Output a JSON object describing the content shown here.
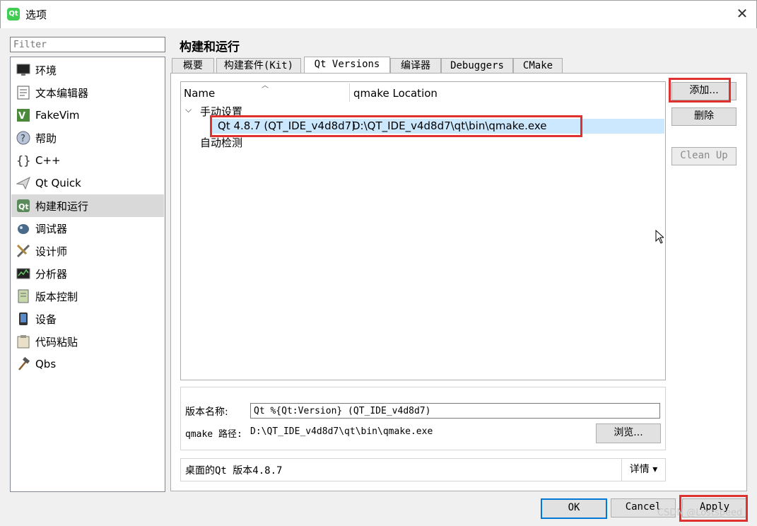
{
  "window": {
    "icon_text": "Qt",
    "title": "选项",
    "close": "✕"
  },
  "sidebar": {
    "filter_placeholder": "Filter",
    "items": [
      {
        "label": "环境",
        "icon": "monitor-icon"
      },
      {
        "label": "文本编辑器",
        "icon": "text-editor-icon"
      },
      {
        "label": "FakeVim",
        "icon": "fakevim-icon"
      },
      {
        "label": "帮助",
        "icon": "help-icon"
      },
      {
        "label": "C++",
        "icon": "braces-icon"
      },
      {
        "label": "Qt Quick",
        "icon": "paper-plane-icon"
      },
      {
        "label": "构建和运行",
        "icon": "qt-build-icon"
      },
      {
        "label": "调试器",
        "icon": "bug-icon"
      },
      {
        "label": "设计师",
        "icon": "designer-tools-icon"
      },
      {
        "label": "分析器",
        "icon": "analyzer-icon"
      },
      {
        "label": "版本控制",
        "icon": "version-control-icon"
      },
      {
        "label": "设备",
        "icon": "device-icon"
      },
      {
        "label": "代码粘贴",
        "icon": "clipboard-icon"
      },
      {
        "label": "Qbs",
        "icon": "hammer-icon"
      }
    ],
    "selected_index": 6
  },
  "main": {
    "title": "构建和运行",
    "tabs": [
      "概要",
      "构建套件(Kit)",
      "Qt Versions",
      "编译器",
      "Debuggers",
      "CMake"
    ],
    "active_tab": 2,
    "tree": {
      "columns": [
        "Name",
        "qmake Location"
      ],
      "groups": [
        {
          "label": "手动设置",
          "expanded": true,
          "children": [
            {
              "name": "Qt 4.8.7 (QT_IDE_v4d8d7)",
              "location": "D:\\QT_IDE_v4d8d7\\qt\\bin\\qmake.exe"
            }
          ]
        },
        {
          "label": "自动检测",
          "children": []
        }
      ]
    },
    "buttons": {
      "add": "添加...",
      "remove": "删除",
      "cleanup": "Clean Up"
    },
    "details": {
      "version_name_label": "版本名称:",
      "version_name_value": "Qt %{Qt:Version} (QT_IDE_v4d8d7)",
      "qmake_path_label": "qmake 路径:",
      "qmake_path_value": "D:\\QT_IDE_v4d8d7\\qt\\bin\\qmake.exe",
      "browse": "浏览..."
    },
    "info": {
      "text": "桌面的Qt 版本4.8.7",
      "details_button": "详情 ▾"
    }
  },
  "footer": {
    "ok": "OK",
    "cancel": "Cancel",
    "apply": "Apply",
    "watermark": "CSDN @Lostspeed"
  },
  "colors": {
    "highlight": "#e03131",
    "selection": "#cce8ff",
    "focus": "#0078d7",
    "qt_green": "#41cd52"
  }
}
